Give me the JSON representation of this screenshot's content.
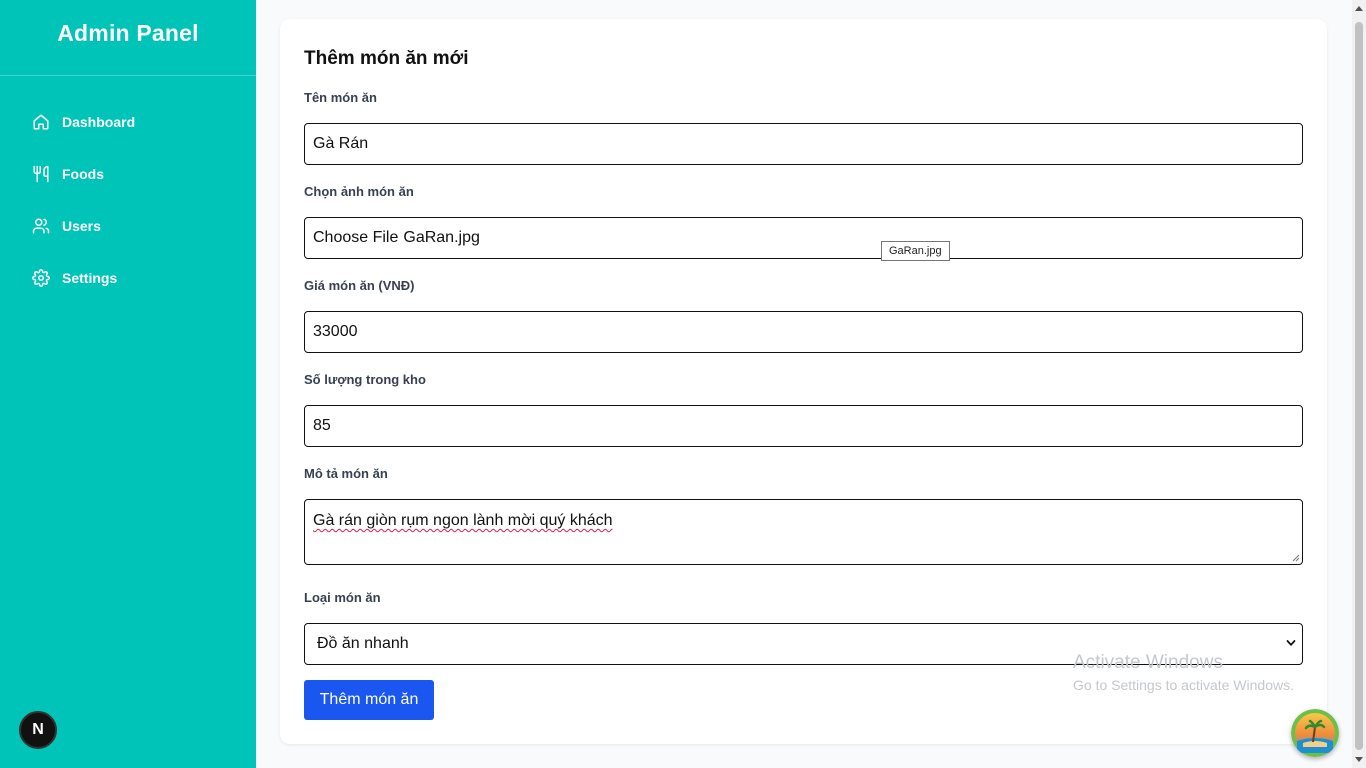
{
  "sidebar": {
    "title": "Admin Panel",
    "items": [
      {
        "label": "Dashboard",
        "icon": "home-icon"
      },
      {
        "label": "Foods",
        "icon": "utensils-icon"
      },
      {
        "label": "Users",
        "icon": "users-icon"
      },
      {
        "label": "Settings",
        "icon": "gear-icon"
      }
    ],
    "badge": "N"
  },
  "form": {
    "title": "Thêm món ăn mới",
    "name": {
      "label": "Tên món ăn",
      "value": "Gà Rán"
    },
    "image": {
      "label": "Chọn ảnh món ăn",
      "button": "Choose File",
      "filename": "GaRan.jpg",
      "tooltip": "GaRan.jpg"
    },
    "price": {
      "label": "Giá món ăn (VNĐ)",
      "value": "33000"
    },
    "stock": {
      "label": "Số lượng trong kho",
      "value": "85"
    },
    "description": {
      "label": "Mô tả món ăn",
      "value": "Gà rán giòn rụm ngon lành mời quý khách"
    },
    "category": {
      "label": "Loại món ăn",
      "value": "Đồ ăn nhanh"
    },
    "submit": "Thêm món ăn"
  },
  "watermark": {
    "line1": "Activate Windows",
    "line2": "Go to Settings to activate Windows."
  },
  "colors": {
    "sidebar": "#00c4b8",
    "primary": "#1a56f0"
  }
}
